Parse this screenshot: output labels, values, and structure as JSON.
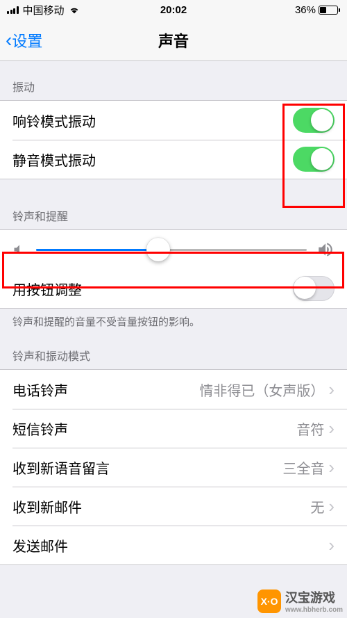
{
  "status": {
    "carrier": "中国移动",
    "time": "20:02",
    "battery_pct": "36%"
  },
  "nav": {
    "back_label": "设置",
    "title": "声音"
  },
  "sections": {
    "vibrate": {
      "header": "振动",
      "ring_vibrate_label": "响铃模式振动",
      "ring_vibrate_on": true,
      "silent_vibrate_label": "静音模式振动",
      "silent_vibrate_on": true
    },
    "ringer": {
      "header": "铃声和提醒",
      "slider_value": 0.45,
      "change_with_buttons_label": "用按钮调整",
      "change_with_buttons_on": false,
      "footer": "铃声和提醒的音量不受音量按钮的影响。"
    },
    "patterns": {
      "header": "铃声和振动模式",
      "items": [
        {
          "label": "电话铃声",
          "value": "情非得已（女声版）"
        },
        {
          "label": "短信铃声",
          "value": "音符"
        },
        {
          "label": "收到新语音留言",
          "value": "三全音"
        },
        {
          "label": "收到新邮件",
          "value": "无"
        },
        {
          "label": "发送邮件",
          "value": ""
        }
      ]
    }
  },
  "watermark": {
    "badge": "X·O",
    "main": "汉宝游戏",
    "sub": "www.hbherb.com"
  },
  "highlight_color": "#ff0000"
}
